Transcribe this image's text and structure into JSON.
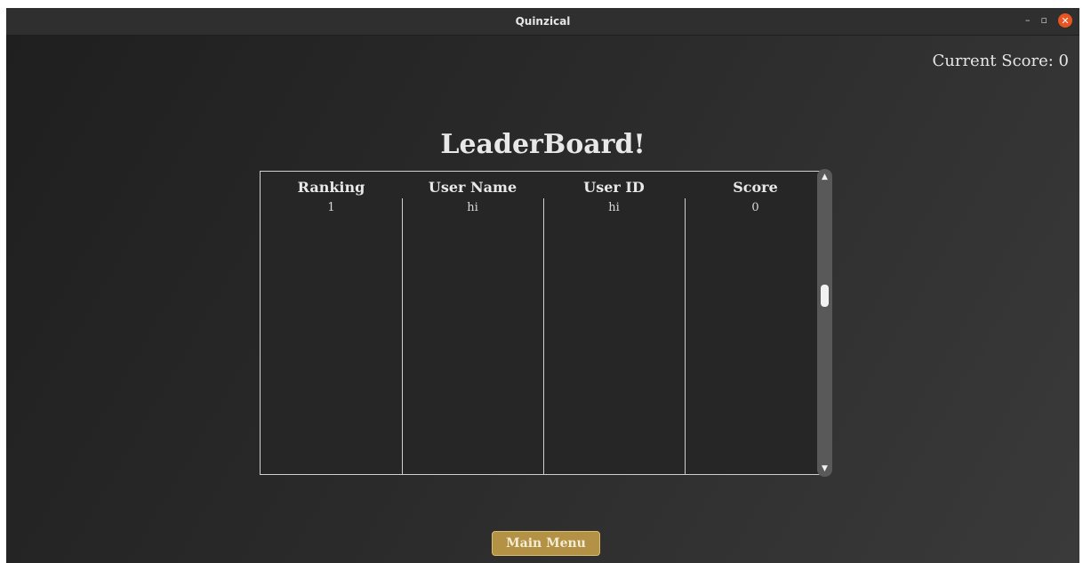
{
  "window": {
    "title": "Quinzical",
    "minimize": "–",
    "maximize": "▫",
    "close": "✕"
  },
  "score": {
    "label": "Current Score: 0"
  },
  "leaderboard": {
    "heading": "LeaderBoard!",
    "columns": [
      "Ranking",
      "User Name",
      "User ID",
      "Score"
    ],
    "rows": [
      [
        "1",
        "hi",
        "hi",
        "0"
      ]
    ]
  },
  "scrollbar": {
    "up": "▲",
    "down": "▼"
  },
  "actions": {
    "main_menu": "Main Menu"
  },
  "colors": {
    "accent": "#b39145",
    "close": "#e95420"
  }
}
